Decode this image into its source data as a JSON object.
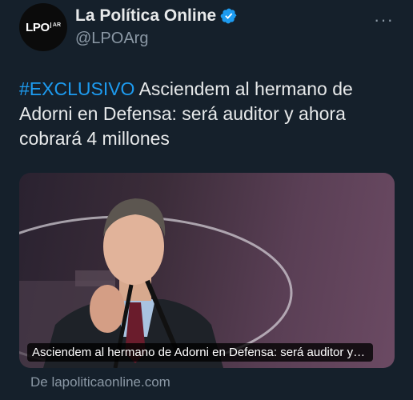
{
  "account": {
    "avatar_text": "LPO",
    "avatar_sup": "AR",
    "display_name": "La Política Online",
    "handle": "@LPOArg",
    "verified_icon": "verified-badge-icon",
    "more_icon": "more-icon"
  },
  "tweet": {
    "hashtag": "#EXCLUSIVO",
    "text": " Asciendem al hermano de Adorni en Defensa: será auditor y ahora cobrará 4 millones"
  },
  "card": {
    "caption": "Asciendem al hermano de Adorni en Defensa: será auditor y ah...",
    "source": "De lapoliticaonline.com"
  },
  "colors": {
    "background": "#15202b",
    "accent": "#1d9bf0",
    "secondary_text": "#8b98a5"
  }
}
